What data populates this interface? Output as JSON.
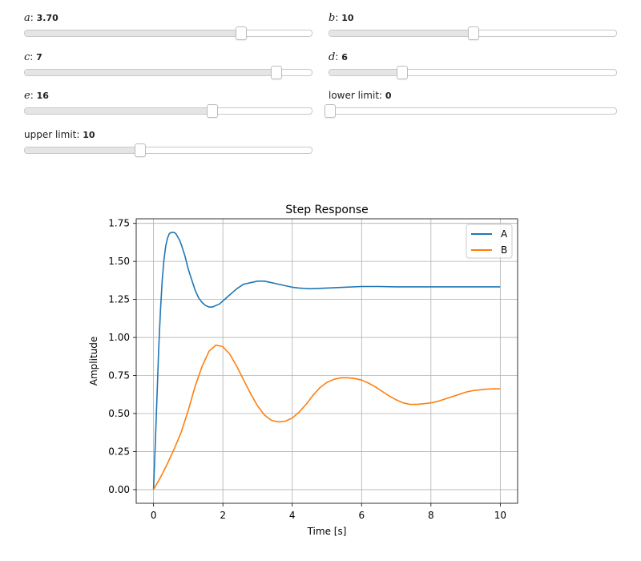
{
  "sliders": [
    {
      "id": "a",
      "symbol": "a",
      "sep": ": ",
      "value": "3.70",
      "fraction": 0.75
    },
    {
      "id": "b",
      "symbol": "b",
      "sep": ": ",
      "value": "10",
      "fraction": 0.5
    },
    {
      "id": "c",
      "symbol": "c",
      "sep": ": ",
      "value": "7",
      "fraction": 0.875
    },
    {
      "id": "d",
      "symbol": "d",
      "sep": ": ",
      "value": "6",
      "fraction": 0.25
    },
    {
      "id": "e",
      "symbol": "e",
      "sep": ": ",
      "value": "16",
      "fraction": 0.65
    },
    {
      "id": "lower",
      "label": "lower limit: ",
      "value": "0",
      "fraction": 0.0
    },
    {
      "id": "upper",
      "label": "upper limit: ",
      "value": "10",
      "fraction": 0.4
    }
  ],
  "colors": {
    "A": "#1f77b4",
    "B": "#ff7f0e",
    "grid": "#b0b0b0"
  },
  "chart_data": {
    "type": "line",
    "title": "Step Response",
    "xlabel": "Time [s]",
    "ylabel": "Amplitude",
    "xlim": [
      -0.5,
      10.5
    ],
    "ylim": [
      -0.09,
      1.78
    ],
    "xticks": [
      0,
      2,
      4,
      6,
      8,
      10
    ],
    "yticks": [
      0.0,
      0.25,
      0.5,
      0.75,
      1.0,
      1.25,
      1.5,
      1.75
    ],
    "grid": true,
    "legend": "top-right",
    "series": [
      {
        "name": "A",
        "color": "#1f77b4",
        "x": [
          0,
          0.05,
          0.1,
          0.15,
          0.2,
          0.25,
          0.3,
          0.35,
          0.4,
          0.45,
          0.5,
          0.55,
          0.6,
          0.65,
          0.7,
          0.75,
          0.8,
          0.9,
          1.0,
          1.1,
          1.2,
          1.3,
          1.4,
          1.5,
          1.6,
          1.7,
          1.8,
          1.9,
          2.0,
          2.2,
          2.4,
          2.6,
          2.8,
          3.0,
          3.2,
          3.4,
          3.6,
          3.8,
          4.0,
          4.2,
          4.5,
          5.0,
          5.5,
          6.0,
          6.5,
          7.0,
          7.5,
          8.0,
          8.5,
          9.0,
          9.5,
          10.0
        ],
        "y": [
          0,
          0.3,
          0.62,
          0.93,
          1.18,
          1.38,
          1.51,
          1.6,
          1.65,
          1.68,
          1.69,
          1.69,
          1.69,
          1.68,
          1.66,
          1.64,
          1.61,
          1.54,
          1.45,
          1.38,
          1.31,
          1.26,
          1.23,
          1.21,
          1.2,
          1.2,
          1.21,
          1.22,
          1.24,
          1.28,
          1.32,
          1.35,
          1.36,
          1.37,
          1.37,
          1.36,
          1.35,
          1.34,
          1.33,
          1.325,
          1.32,
          1.325,
          1.33,
          1.335,
          1.335,
          1.333,
          1.333,
          1.333,
          1.333,
          1.333,
          1.333,
          1.333
        ]
      },
      {
        "name": "B",
        "color": "#ff7f0e",
        "x": [
          0,
          0.2,
          0.4,
          0.6,
          0.8,
          1.0,
          1.2,
          1.4,
          1.6,
          1.8,
          2.0,
          2.2,
          2.4,
          2.6,
          2.8,
          3.0,
          3.2,
          3.4,
          3.6,
          3.8,
          4.0,
          4.2,
          4.4,
          4.6,
          4.8,
          5.0,
          5.2,
          5.4,
          5.6,
          5.8,
          6.0,
          6.2,
          6.4,
          6.6,
          6.8,
          7.0,
          7.2,
          7.4,
          7.6,
          7.8,
          8.0,
          8.2,
          8.4,
          8.6,
          8.8,
          9.0,
          9.2,
          9.4,
          9.6,
          9.8,
          10.0
        ],
        "y": [
          0,
          0.08,
          0.17,
          0.27,
          0.38,
          0.52,
          0.68,
          0.81,
          0.91,
          0.95,
          0.94,
          0.89,
          0.81,
          0.72,
          0.63,
          0.55,
          0.49,
          0.455,
          0.445,
          0.45,
          0.47,
          0.51,
          0.56,
          0.62,
          0.67,
          0.705,
          0.725,
          0.735,
          0.735,
          0.73,
          0.72,
          0.7,
          0.675,
          0.645,
          0.615,
          0.59,
          0.57,
          0.56,
          0.56,
          0.565,
          0.57,
          0.58,
          0.595,
          0.61,
          0.625,
          0.64,
          0.65,
          0.655,
          0.66,
          0.662,
          0.662
        ]
      }
    ]
  }
}
